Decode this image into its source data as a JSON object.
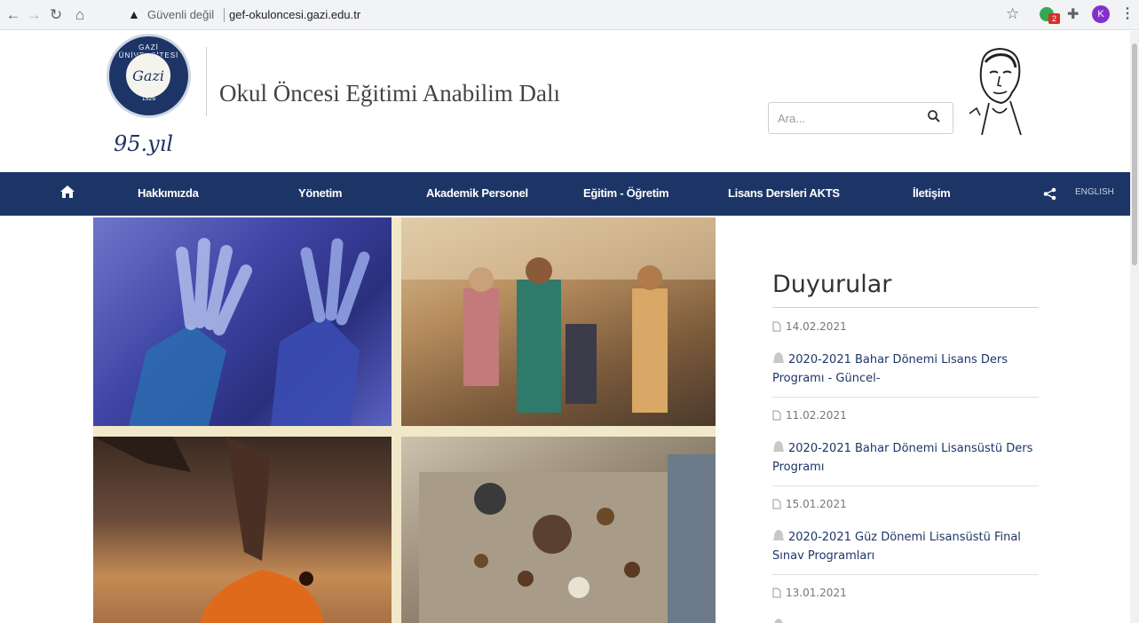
{
  "browser": {
    "security_label": "Güvenli değil",
    "url": "gef-okuloncesi.gazi.edu.tr",
    "extension_badge": "2",
    "profile_initial": "K"
  },
  "header": {
    "logo_ring_text": "GAZİ ÜNİVERSİTESİ",
    "logo_center_text": "Gazi",
    "logo_year": "1926",
    "anniversary_text": "95.yıl",
    "site_title": "Okul Öncesi Eğitimi Anabilim Dalı",
    "search_placeholder": "Ara..."
  },
  "nav": {
    "items": [
      "Hakkımızda",
      "Yönetim",
      "Akademik Personel",
      "Eğitim - Öğretim",
      "Lisans Dersleri AKTS",
      "İletişim"
    ],
    "language": "ENGLISH"
  },
  "announcements": {
    "heading": "Duyurular",
    "items": [
      {
        "date": "14.02.2021",
        "title": "2020-2021 Bahar Dönemi Lisans Ders Programı - Güncel-"
      },
      {
        "date": "11.02.2021",
        "title": "2020-2021 Bahar Dönemi Lisansüstü Ders Programı"
      },
      {
        "date": "15.01.2021",
        "title": "2020-2021 Güz Dönemi Lisansüstü Final Sınav Programları"
      },
      {
        "date": "13.01.2021",
        "title": ""
      }
    ]
  },
  "colors": {
    "nav_bg": "#1d3566",
    "link": "#1d3566"
  }
}
